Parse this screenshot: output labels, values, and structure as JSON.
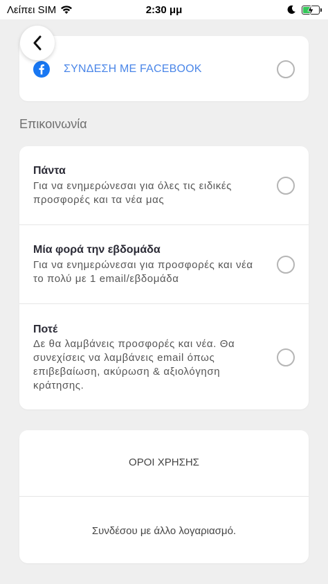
{
  "status_bar": {
    "carrier": "Λείπει SIM",
    "time": "2:30 μμ"
  },
  "facebook": {
    "label": "ΣΥΝΔΕΣΗ ΜΕ FACEBOOK"
  },
  "communication": {
    "section_title": "Επικοινωνία",
    "options": [
      {
        "title": "Πάντα",
        "description": "Για να ενημερώνεσαι για όλες τις ειδικές προσφορές και τα νέα μας"
      },
      {
        "title": "Μία φορά την εβδομάδα",
        "description": "Για να ενημερώνεσαι για προσφορές και νέα το πολύ με 1 email/εβδομάδα"
      },
      {
        "title": "Ποτέ",
        "description": "Δε θα λαμβάνεις προσφορές και νέα. Θα συνεχίσεις να λαμβάνεις email όπως επιβεβαίωση, ακύρωση & αξιολόγηση κράτησης."
      }
    ]
  },
  "links": {
    "terms": "ΟΡΟΙ ΧΡΗΣΗΣ",
    "switch_account": "Συνδέσου με άλλο λογαριασμό."
  },
  "colors": {
    "accent": "#4a86e8",
    "facebook": "#1877f2",
    "battery": "#34c759",
    "background": "#efefef"
  },
  "icons": [
    "back-chevron-icon",
    "facebook-icon",
    "wifi-icon",
    "moon-icon",
    "battery-charging-icon"
  ]
}
